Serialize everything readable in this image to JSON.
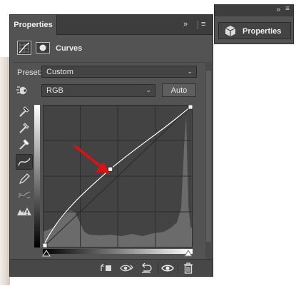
{
  "panel": {
    "tab_label": "Properties",
    "adjustment_title": "Curves",
    "preset_label": "Preset:",
    "preset_value": "Custom",
    "channel_value": "RGB",
    "auto_label": "Auto"
  },
  "mini_panel": {
    "button_label": "Properties"
  },
  "icons": {
    "expand": "double-chevron-right-icon",
    "menu": "hamburger-menu-icon",
    "curves_adjustment": "curves-adjustment-icon",
    "layer_mask": "layer-mask-icon",
    "on_image_adjust": "hand-target-icon",
    "eyedropper_black": "eyedropper-black-icon",
    "eyedropper_gray": "eyedropper-gray-icon",
    "eyedropper_white": "eyedropper-white-icon",
    "curve_points": "curve-points-icon",
    "pencil": "pencil-icon",
    "smooth": "smooth-icon",
    "clipping_warning": "clipping-warning-icon",
    "clip_to_layer": "clip-to-layer-icon",
    "view_previous": "view-previous-state-icon",
    "reset": "reset-icon",
    "visibility": "eye-icon",
    "delete": "trash-icon",
    "properties_panel": "properties-cube-icon"
  },
  "curve": {
    "control_points": [
      [
        0,
        0
      ],
      [
        115,
        140
      ],
      [
        255,
        255
      ]
    ],
    "histogram_color": "#6b6b6b",
    "line_color": "#ffffff"
  },
  "annotation": {
    "arrow_color": "#e01010"
  }
}
